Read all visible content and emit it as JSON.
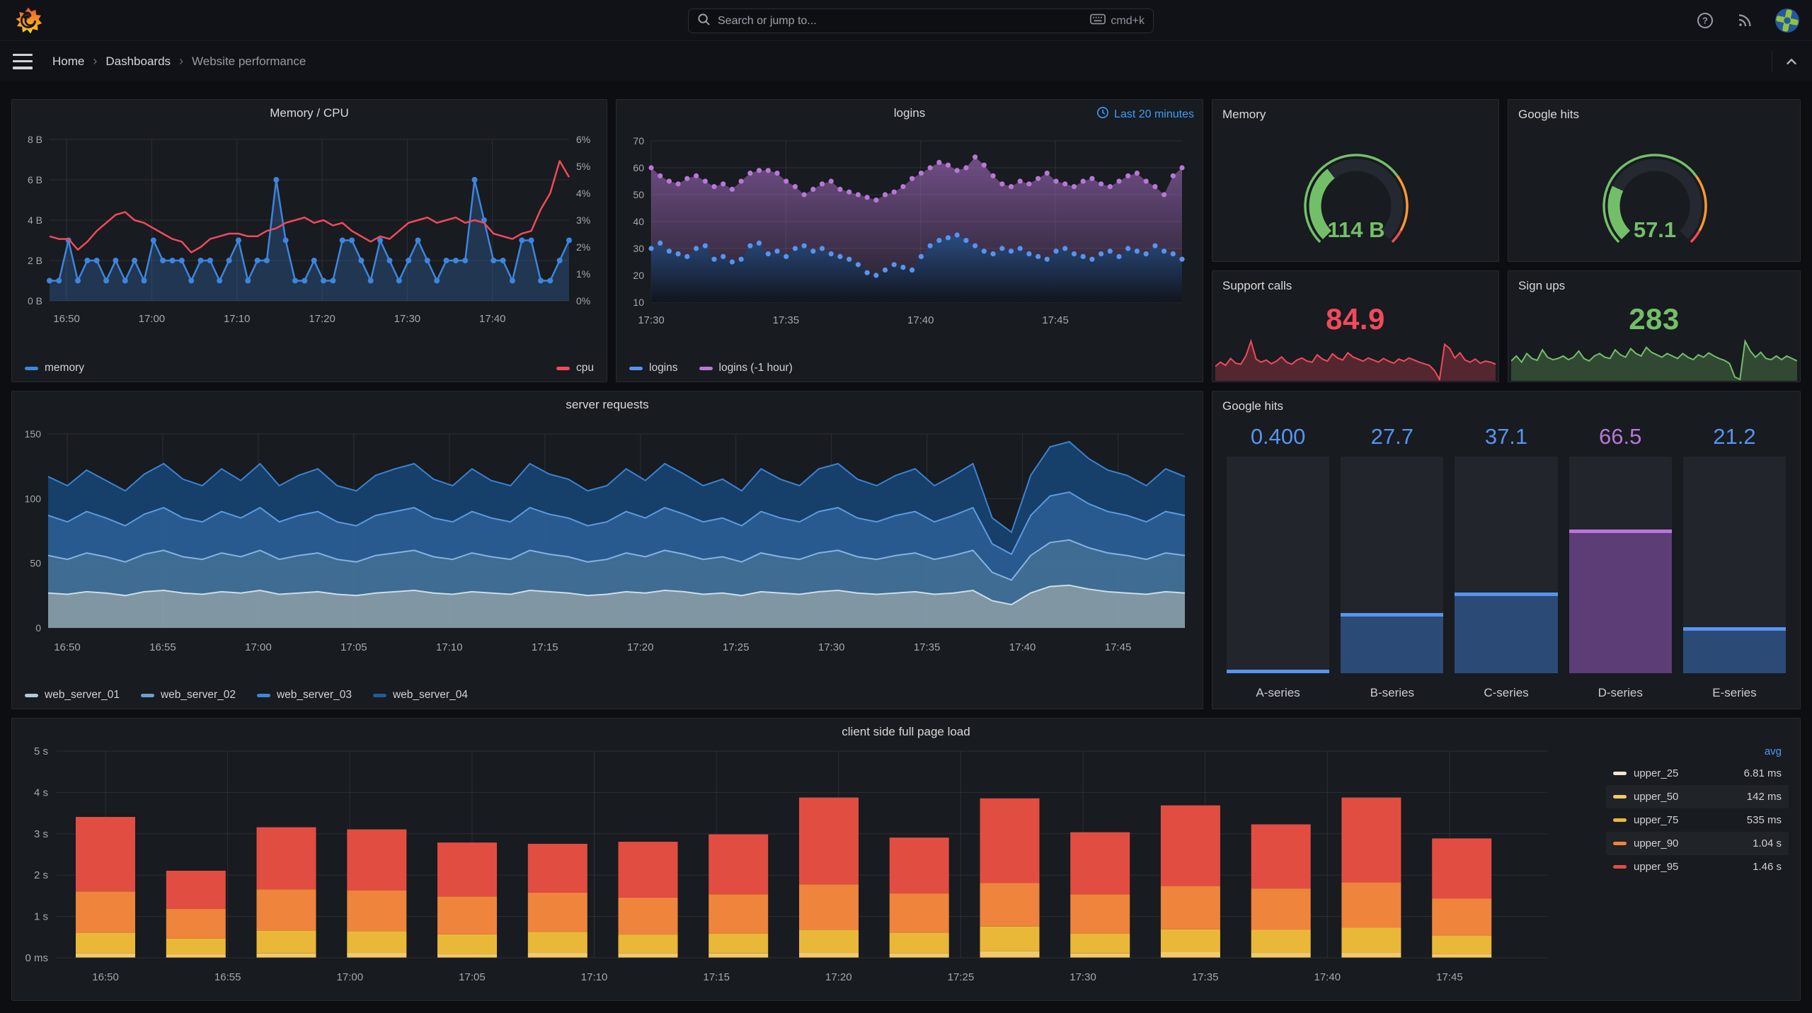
{
  "topbar": {
    "search_placeholder": "Search or jump to...",
    "search_shortcut": "cmd+k"
  },
  "breadcrumb": {
    "items": [
      "Home",
      "Dashboards",
      "Website performance"
    ]
  },
  "panels": {
    "memory_cpu": {
      "title": "Memory / CPU"
    },
    "logins": {
      "title": "logins",
      "time_override": "Last 20 minutes"
    },
    "memory_gauge": {
      "title": "Memory",
      "value": "114 B"
    },
    "google_hits_gauge": {
      "title": "Google hits",
      "value": "57.1"
    },
    "support_calls": {
      "title": "Support calls",
      "value": "84.9"
    },
    "sign_ups": {
      "title": "Sign ups",
      "value": "283"
    },
    "server_requests": {
      "title": "server requests"
    },
    "google_hits_bars": {
      "title": "Google hits"
    },
    "page_load": {
      "title": "client side full page load",
      "legend_header": "avg"
    }
  },
  "colors": {
    "blue": "#5794F2",
    "purple": "#B877D9",
    "green": "#73BF69",
    "red": "#F2495C",
    "orange": "#FF9830",
    "time_indicator": "#3D9DFF"
  },
  "chart_data": {
    "memory_cpu": {
      "type": "line",
      "title": "Memory / CPU",
      "x_ticks": [
        "16:50",
        "17:00",
        "17:10",
        "17:20",
        "17:30",
        "17:40"
      ],
      "y_left_ticks": [
        "0 B",
        "2 B",
        "4 B",
        "6 B",
        "8 B"
      ],
      "y_left_range": [
        0,
        8
      ],
      "y_right_ticks": [
        "0%",
        "1%",
        "2%",
        "3%",
        "4%",
        "5%",
        "6%"
      ],
      "y_right_range": [
        0,
        6
      ],
      "series": [
        {
          "name": "memory",
          "axis": "left",
          "color": "#3D85DE",
          "values": [
            1,
            1,
            3,
            1,
            2,
            2,
            1,
            2,
            1,
            2,
            1,
            3,
            2,
            2,
            2,
            1,
            2,
            2,
            1,
            2,
            3,
            1,
            2,
            2,
            6,
            3,
            1,
            1,
            2,
            1,
            1,
            3,
            3,
            2,
            1,
            3,
            2,
            1,
            2,
            3,
            2,
            1,
            2,
            2,
            2,
            6,
            4,
            2,
            2,
            1,
            3,
            3,
            1,
            1,
            2,
            3
          ]
        },
        {
          "name": "cpu",
          "axis": "right",
          "color": "#F2495C",
          "values": [
            2.4,
            2.3,
            2.3,
            1.9,
            2.2,
            2.6,
            2.9,
            3.2,
            3.3,
            3.0,
            2.9,
            2.7,
            2.5,
            2.3,
            2.2,
            1.8,
            2.0,
            2.3,
            2.4,
            2.5,
            2.5,
            2.4,
            2.4,
            2.6,
            2.7,
            2.9,
            3.0,
            3.1,
            2.9,
            3.0,
            2.8,
            2.9,
            2.6,
            2.4,
            2.2,
            2.4,
            2.3,
            2.6,
            2.9,
            3.0,
            3.1,
            2.9,
            3.0,
            3.1,
            2.9,
            3.0,
            2.9,
            2.5,
            2.4,
            2.3,
            2.5,
            2.6,
            3.4,
            4.0,
            5.2,
            4.6
          ]
        }
      ]
    },
    "logins": {
      "type": "scatter-area",
      "title": "logins",
      "time_override": "Last 20 minutes",
      "x_ticks": [
        "17:30",
        "17:35",
        "17:40",
        "17:45"
      ],
      "y_ticks": [
        "10",
        "20",
        "30",
        "40",
        "50",
        "60",
        "70"
      ],
      "y_range": [
        10,
        70
      ],
      "series": [
        {
          "name": "logins",
          "color": "#5794F2",
          "values": [
            30,
            32,
            29,
            28,
            27,
            30,
            31,
            26,
            27,
            25,
            26,
            31,
            32,
            28,
            29,
            27,
            30,
            31,
            29,
            30,
            28,
            27,
            26,
            24,
            21,
            20,
            22,
            24,
            23,
            22,
            27,
            31,
            33,
            34,
            35,
            33,
            31,
            29,
            28,
            30,
            29,
            30,
            28,
            27,
            26,
            29,
            30,
            28,
            27,
            26,
            28,
            29,
            27,
            30,
            29,
            28,
            31,
            29,
            28,
            26
          ]
        },
        {
          "name": "logins (-1 hour)",
          "color": "#B877D9",
          "values": [
            60,
            57,
            55,
            54,
            56,
            57,
            55,
            53,
            54,
            52,
            55,
            58,
            59,
            59,
            58,
            55,
            53,
            50,
            52,
            54,
            55,
            52,
            51,
            50,
            49,
            48,
            50,
            51,
            53,
            56,
            58,
            60,
            62,
            61,
            59,
            60,
            64,
            61,
            57,
            54,
            53,
            55,
            54,
            56,
            58,
            55,
            54,
            53,
            55,
            56,
            54,
            53,
            55,
            57,
            58,
            55,
            53,
            50,
            57,
            60
          ]
        }
      ]
    },
    "server_requests": {
      "type": "stacked-area",
      "title": "server requests",
      "x_ticks": [
        "16:50",
        "16:55",
        "17:00",
        "17:05",
        "17:10",
        "17:15",
        "17:20",
        "17:25",
        "17:30",
        "17:35",
        "17:40",
        "17:45"
      ],
      "y_ticks": [
        "0",
        "50",
        "100",
        "150"
      ],
      "y_range": [
        0,
        150
      ],
      "series": [
        {
          "name": "web_server_01",
          "color": "#AECBDD",
          "fill": "#93ACBB",
          "values": [
            27,
            26,
            28,
            27,
            25,
            28,
            29,
            27,
            26,
            28,
            27,
            29,
            26,
            27,
            28,
            26,
            25,
            27,
            28,
            29,
            27,
            26,
            28,
            27,
            26,
            29,
            28,
            27,
            25,
            26,
            28,
            27,
            29,
            28,
            26,
            27,
            25,
            28,
            27,
            26,
            28,
            29,
            27,
            26,
            27,
            28,
            26,
            27,
            29,
            21,
            18,
            27,
            32,
            33,
            30,
            28,
            27,
            26,
            28,
            27
          ]
        },
        {
          "name": "web_server_02",
          "color": "#6C9FCF",
          "fill": "#44759E",
          "values": [
            29,
            27,
            30,
            28,
            26,
            29,
            31,
            28,
            27,
            30,
            28,
            31,
            27,
            29,
            30,
            27,
            26,
            29,
            30,
            31,
            28,
            27,
            30,
            28,
            27,
            31,
            29,
            28,
            26,
            27,
            30,
            28,
            31,
            29,
            27,
            28,
            26,
            30,
            28,
            27,
            30,
            31,
            28,
            27,
            29,
            30,
            27,
            29,
            31,
            22,
            19,
            29,
            34,
            35,
            32,
            30,
            29,
            27,
            30,
            29
          ]
        },
        {
          "name": "web_server_03",
          "color": "#3E86D8",
          "fill": "#2A5E96",
          "values": [
            31,
            29,
            32,
            30,
            28,
            31,
            33,
            30,
            29,
            32,
            30,
            33,
            29,
            31,
            32,
            29,
            28,
            31,
            32,
            33,
            30,
            29,
            32,
            30,
            29,
            33,
            31,
            30,
            28,
            29,
            32,
            30,
            33,
            31,
            29,
            30,
            28,
            32,
            30,
            29,
            32,
            33,
            30,
            29,
            31,
            32,
            29,
            31,
            33,
            22,
            20,
            31,
            36,
            37,
            34,
            32,
            31,
            29,
            32,
            31
          ]
        },
        {
          "name": "web_server_04",
          "color": "#1F5C99",
          "fill": "#16416E",
          "values": [
            30,
            28,
            32,
            29,
            27,
            31,
            34,
            30,
            28,
            33,
            29,
            34,
            28,
            31,
            33,
            28,
            27,
            31,
            33,
            34,
            30,
            28,
            33,
            29,
            28,
            34,
            31,
            30,
            27,
            28,
            33,
            29,
            34,
            31,
            28,
            30,
            27,
            33,
            30,
            28,
            33,
            34,
            30,
            28,
            31,
            33,
            28,
            31,
            34,
            20,
            17,
            31,
            38,
            39,
            35,
            32,
            31,
            28,
            33,
            30
          ]
        }
      ]
    },
    "memory_gauge": {
      "type": "gauge",
      "title": "Memory",
      "value_text": "114 B",
      "fraction": 0.36,
      "color": "#73BF69",
      "thresholds": [
        {
          "color": "#73BF69",
          "upto": 0.7
        },
        {
          "color": "#FF9830",
          "upto": 0.94
        },
        {
          "color": "#F2495C",
          "upto": 1.0
        }
      ]
    },
    "google_hits_gauge": {
      "type": "gauge",
      "title": "Google hits",
      "value_text": "57.1",
      "fraction": 0.26,
      "color": "#73BF69",
      "thresholds": [
        {
          "color": "#73BF69",
          "upto": 0.7
        },
        {
          "color": "#FF9830",
          "upto": 0.94
        },
        {
          "color": "#F2495C",
          "upto": 1.0
        }
      ]
    },
    "support_calls": {
      "type": "stat",
      "title": "Support calls",
      "value_text": "84.9",
      "color": "#F2495C",
      "sparkline": [
        30,
        38,
        32,
        45,
        36,
        34,
        50,
        78,
        44,
        38,
        42,
        35,
        40,
        48,
        38,
        34,
        42,
        46,
        40,
        38,
        52,
        44,
        40,
        54,
        46,
        42,
        56,
        48,
        44,
        40,
        46,
        42,
        38,
        45,
        40,
        36,
        44,
        40,
        46,
        42,
        38,
        35,
        32,
        22,
        5,
        72,
        64,
        46,
        56,
        42,
        38,
        44,
        36,
        40,
        38,
        34
      ]
    },
    "sign_ups": {
      "type": "stat",
      "title": "Sign ups",
      "value_text": "283",
      "color": "#73BF69",
      "sparkline": [
        44,
        52,
        42,
        56,
        48,
        45,
        62,
        50,
        46,
        48,
        52,
        46,
        50,
        60,
        48,
        44,
        52,
        56,
        50,
        48,
        62,
        54,
        50,
        64,
        56,
        52,
        66,
        58,
        54,
        50,
        56,
        52,
        48,
        56,
        50,
        46,
        54,
        50,
        57,
        52,
        48,
        45,
        40,
        18,
        14,
        76,
        60,
        50,
        58,
        48,
        46,
        52,
        46,
        52,
        48,
        44
      ]
    },
    "google_hits_bars": {
      "type": "bar",
      "title": "Google hits",
      "max": 100,
      "bars": [
        {
          "label": "A-series",
          "value": 0.4,
          "value_text": "0.400",
          "color": "#5794F2",
          "fill": "#2C4A76"
        },
        {
          "label": "B-series",
          "value": 27.7,
          "value_text": "27.7",
          "color": "#5794F2",
          "fill": "#2C4A76"
        },
        {
          "label": "C-series",
          "value": 37.1,
          "value_text": "37.1",
          "color": "#5794F2",
          "fill": "#2C4A76"
        },
        {
          "label": "D-series",
          "value": 66.5,
          "value_text": "66.5",
          "color": "#B877D9",
          "fill": "#5C3D75"
        },
        {
          "label": "E-series",
          "value": 21.2,
          "value_text": "21.2",
          "color": "#5794F2",
          "fill": "#2C4A76"
        }
      ]
    },
    "page_load": {
      "type": "bar",
      "stacked": true,
      "title": "client side full page load",
      "x_ticks": [
        "16:50",
        "16:55",
        "17:00",
        "17:05",
        "17:10",
        "17:15",
        "17:20",
        "17:25",
        "17:30",
        "17:35",
        "17:40",
        "17:45"
      ],
      "y_ticks": [
        "0 ms",
        "1 s",
        "2 s",
        "3 s",
        "4 s",
        "5 s"
      ],
      "y_range": [
        0,
        5
      ],
      "legend_header": "avg",
      "series": [
        {
          "name": "upper_25",
          "color": "#F9E2D2",
          "avg": "6.81 ms",
          "values": [
            0.007,
            0.007,
            0.007,
            0.007,
            0.007,
            0.007,
            0.007,
            0.007,
            0.007,
            0.007,
            0.007,
            0.007,
            0.007,
            0.007,
            0.007,
            0.007
          ]
        },
        {
          "name": "upper_50",
          "color": "#F2C96D",
          "avg": "142 ms",
          "values": [
            0.1,
            0.08,
            0.1,
            0.12,
            0.08,
            0.12,
            0.1,
            0.1,
            0.12,
            0.1,
            0.15,
            0.1,
            0.13,
            0.12,
            0.12,
            0.08
          ]
        },
        {
          "name": "upper_75",
          "color": "#EAB839",
          "avg": "535 ms",
          "values": [
            0.5,
            0.38,
            0.55,
            0.52,
            0.48,
            0.5,
            0.45,
            0.48,
            0.55,
            0.5,
            0.6,
            0.48,
            0.55,
            0.55,
            0.6,
            0.45
          ]
        },
        {
          "name": "upper_90",
          "color": "#EF843C",
          "avg": "1.04 s",
          "values": [
            1.0,
            0.72,
            1.0,
            0.98,
            0.92,
            0.95,
            0.9,
            0.95,
            1.1,
            0.95,
            1.05,
            0.95,
            1.05,
            1.0,
            1.1,
            0.9
          ]
        },
        {
          "name": "upper_95",
          "color": "#E24D42",
          "avg": "1.46 s",
          "values": [
            1.8,
            0.92,
            1.5,
            1.48,
            1.3,
            1.18,
            1.35,
            1.45,
            2.1,
            1.35,
            2.05,
            1.5,
            1.95,
            1.55,
            2.05,
            1.45
          ]
        }
      ]
    }
  }
}
